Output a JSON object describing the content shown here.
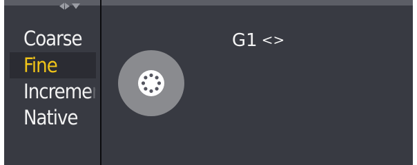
{
  "resolution_modes": {
    "items": [
      {
        "label": "Coarse",
        "active": false
      },
      {
        "label": "Fine",
        "active": true
      },
      {
        "label": "Increment",
        "active": false
      },
      {
        "label": "Native",
        "active": false
      }
    ]
  },
  "encoder": {
    "name": "G1",
    "arrows": "<>",
    "icon": "rotary-encoder-icon"
  },
  "header": {
    "collapse_icons": [
      "triangle-left-icon",
      "triangle-right-icon",
      "triangle-down-icon"
    ]
  },
  "colors": {
    "background": "#383a42",
    "top_strip": "#5c5e66",
    "active_text": "#f0c419",
    "text": "#f2f2f2",
    "knob": "#8a8b8f",
    "divider": "#0b0b0e"
  }
}
